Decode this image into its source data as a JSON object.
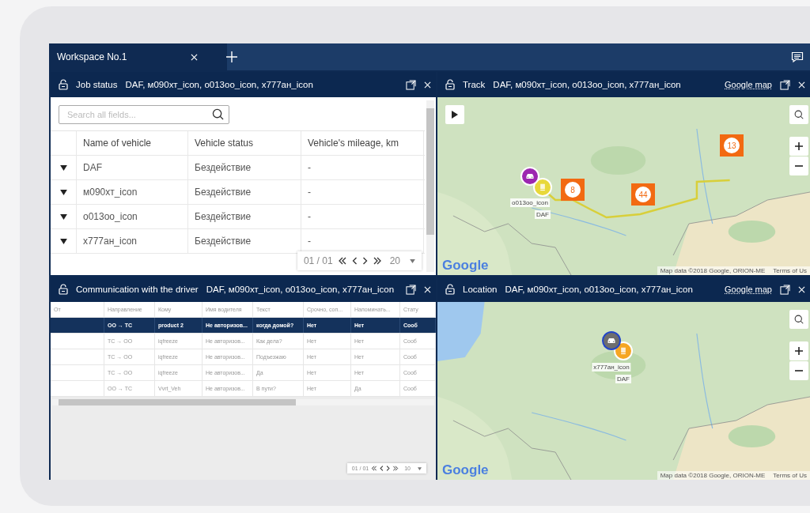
{
  "workspace_tabs": [
    {
      "label": "Workspace No.1",
      "selected": true
    }
  ],
  "panels": [
    {
      "kind": "table",
      "title": "Job status",
      "vehicles": "DAF, м090хт_icon, o013oo_icon, x777ан_icon",
      "search": {
        "placeholder": "Search all fields..."
      },
      "columns": [
        "Name of vehicle",
        "Vehicle status",
        "Vehicle's mileage, km"
      ],
      "rows": [
        {
          "name": "DAF",
          "status": "Бездействие",
          "mileage": "-"
        },
        {
          "name": "м090хт_icon",
          "status": "Бездействие",
          "mileage": "-"
        },
        {
          "name": "o013oo_icon",
          "status": "Бездействие",
          "mileage": "-"
        },
        {
          "name": "x777ан_icon",
          "status": "Бездействие",
          "mileage": "-"
        }
      ],
      "pagination": {
        "page": "01 / 01",
        "page_size": "20"
      }
    },
    {
      "kind": "map",
      "title": "Track",
      "vehicles": "DAF, м090хт_icon, o013oo_icon, x777ан_icon",
      "map_type": "Google map",
      "play_button": true,
      "route": true,
      "clusters": [
        "8",
        "44",
        "13"
      ],
      "markers": [
        {
          "kind": "car",
          "label": "o013oo_icon",
          "color": "#9c27b0",
          "selected": false
        },
        {
          "kind": "truck",
          "label": "DAF",
          "color": "#e8d83a",
          "selected": false
        }
      ],
      "logo": "Google",
      "attribution": "Map data ©2018 Google, ORION-ME",
      "terms": "Terms of Us"
    },
    {
      "kind": "messages",
      "title": "Communication with the driver",
      "vehicles": "DAF, м090хт_icon, o013oo_icon, x777ан_icon",
      "columns": [
        "От",
        "Направление",
        "Кому",
        "Имя водителя",
        "Текст",
        "Срочно, соп...",
        "Напоминать...",
        "Стату"
      ],
      "rows": [
        {
          "selected": true,
          "cells": [
            "",
            "ОО → ТС",
            "product 2",
            "Не авторизов...",
            "когда домой?",
            "Нет",
            "Нет",
            "Сооб"
          ]
        },
        {
          "selected": false,
          "cells": [
            "",
            "ТС → ОО",
            "iqfreeze",
            "Не авторизов...",
            "Как дела?",
            "Нет",
            "Нет",
            "Сооб"
          ]
        },
        {
          "selected": false,
          "cells": [
            "",
            "ТС → ОО",
            "iqfreeze",
            "Не авторизов...",
            "Подъезжаю",
            "Нет",
            "Нет",
            "Сооб"
          ]
        },
        {
          "selected": false,
          "cells": [
            "",
            "ТС → ОО",
            "iqfreeze",
            "Не авторизов...",
            "Да",
            "Нет",
            "Нет",
            "Сооб"
          ]
        },
        {
          "selected": false,
          "cells": [
            "",
            "ОО → ТС",
            "Vvrt_Veh",
            "Не авторизов...",
            "В пути?",
            "Нет",
            "Да",
            "Сооб"
          ]
        }
      ],
      "pagination": {
        "page": "01 / 01",
        "page_size": "10"
      }
    },
    {
      "kind": "map",
      "title": "Location",
      "vehicles": "DAF, м090хт_icon, o013oo_icon, x777ан_icon",
      "map_type": "Google map",
      "markers": [
        {
          "kind": "car",
          "label": "x777ан_icon",
          "color": "#6e6e6e",
          "selected": true
        },
        {
          "kind": "truck",
          "label": "DAF",
          "color": "#f5a623",
          "selected": false
        }
      ],
      "logo": "Google",
      "attribution": "Map data ©2018 Google, ORION-ME",
      "terms": "Terms of Us"
    }
  ]
}
